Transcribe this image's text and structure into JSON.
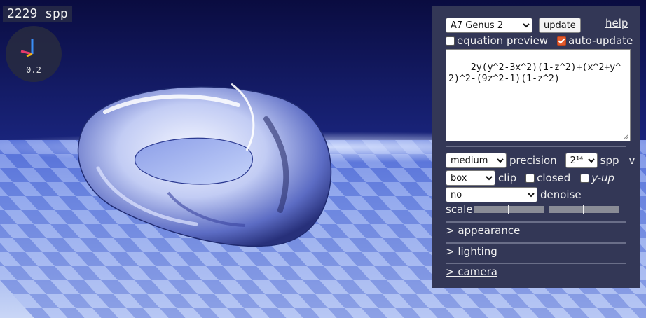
{
  "viewport": {
    "spp_counter": "2229 spp",
    "axis_scale": "0.2"
  },
  "panel": {
    "surface_select": {
      "value": "A7 Genus 2"
    },
    "update_button": "update",
    "help_link": "help",
    "equation_preview": {
      "label": "equation preview",
      "checked": false
    },
    "auto_update": {
      "label": "auto-update",
      "checked": true
    },
    "equation": "2y(y^2-3x^2)(1-z^2)+(x^2+y^2)^2-(9z^2-1)(1-z^2)",
    "precision_select": {
      "value": "medium"
    },
    "precision_label": "precision",
    "spp_select": {
      "value": "2¹⁴"
    },
    "spp_label": "spp",
    "v_label": "v",
    "clip_select": {
      "value": "box"
    },
    "clip_label": "clip",
    "closed": {
      "label": "closed",
      "checked": false
    },
    "y_up": {
      "label": "y-up",
      "checked": false
    },
    "denoise_select": {
      "value": "no"
    },
    "denoise_label": "denoise",
    "scale_label": "scale",
    "scale_slider_1_fraction": 0.5,
    "scale_slider_2_fraction": 0.5,
    "sections": {
      "appearance": "> appearance",
      "lighting": "> lighting",
      "camera": "> camera"
    }
  },
  "colors": {
    "panel_bg": "#333756",
    "auto_update_check": "#e25a2c"
  }
}
